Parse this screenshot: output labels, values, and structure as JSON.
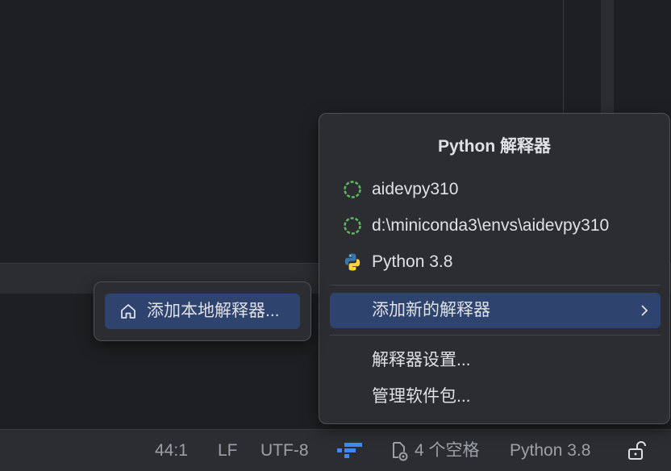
{
  "popup": {
    "title": "Python 解释器",
    "interpreters": [
      {
        "label": "aidevpy310",
        "icon": "conda-env-icon"
      },
      {
        "label": "d:\\miniconda3\\envs\\aidevpy310",
        "icon": "conda-env-icon"
      },
      {
        "label": "Python 3.8",
        "icon": "python-logo-icon"
      }
    ],
    "add_new": "添加新的解释器",
    "settings": "解释器设置...",
    "manage_packages": "管理软件包..."
  },
  "submenu": {
    "add_local": "添加本地解释器..."
  },
  "status_bar": {
    "position": "44:1",
    "line_ending": "LF",
    "encoding": "UTF-8",
    "indent": "4 个空格",
    "interpreter": "Python 3.8"
  },
  "colors": {
    "selection": "#2e436e",
    "conda_green": "#5fb865",
    "python_blue": "#3776ab",
    "python_yellow": "#ffd43b",
    "plugin_blue": "#3d8af7"
  }
}
